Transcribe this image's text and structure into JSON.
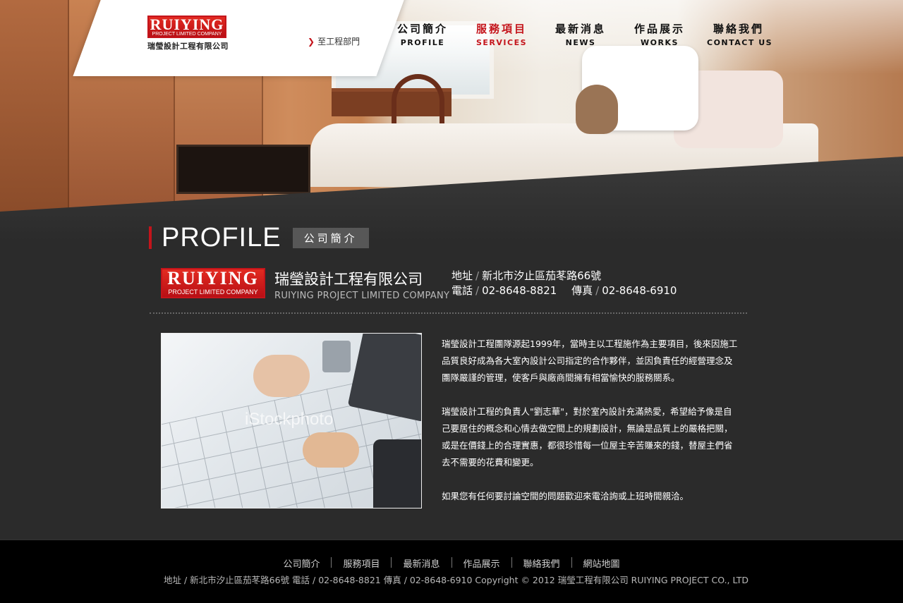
{
  "brand": {
    "mark": "RUIYING",
    "mark_sub": "PROJECT LIMITED COMPANY",
    "name_zh": "瑞瑩設計工程有限公司"
  },
  "header": {
    "dept_link": "至工程部門",
    "nav": [
      {
        "zh": "公司簡介",
        "en": "PROFILE"
      },
      {
        "zh": "服務項目",
        "en": "SERVICES"
      },
      {
        "zh": "最新消息",
        "en": "NEWS"
      },
      {
        "zh": "作品展示",
        "en": "WORKS"
      },
      {
        "zh": "聯絡我們",
        "en": "CONTACT US"
      }
    ]
  },
  "page": {
    "title_en": "PROFILE",
    "title_zh": "公司簡介"
  },
  "company": {
    "logo": "RUIYING",
    "logo_sub": "PROJECT LIMITED COMPANY",
    "name_zh": "瑞瑩設計工程有限公司",
    "name_en": "RUIYING PROJECT LIMITED COMPANY",
    "address_label": "地址",
    "address": "新北市汐止區茄苳路66號",
    "phone_label": "電話",
    "phone": "02-8648-8821",
    "fax_label": "傳真",
    "fax": "02-8648-6910",
    "separator": "/"
  },
  "photo": {
    "watermark": "iStockphoto"
  },
  "content": {
    "paragraphs": [
      "瑞瑩設計工程團隊源起1999年，當時主以工程施作為主要項目，後來因施工品質良好成為各大室內設計公司指定的合作夥伴，並因負責任的經營理念及團隊嚴謹的管理，使客戶與廠商間擁有相當愉快的服務關系。",
      "瑞瑩設計工程的負責人\"劉志華\"，對於室內設計充滿熱愛，希望給予像是自己要居住的概念和心情去做空間上的規劃設計，無論是品質上的嚴格把關，或是在價錢上的合理實惠，都很珍惜每一位屋主辛苦賺來的錢，替屋主們省去不需要的花費和變更。",
      "如果您有任何要討論空間的問題歡迎來電洽詢或上班時間親洽。"
    ]
  },
  "footer": {
    "nav": [
      "公司簡介",
      "服務項目",
      "最新消息",
      "作品展示",
      "聯絡我們",
      "網站地圖"
    ],
    "line": "地址 / 新北市汐止區茄苳路66號  電話 / 02-8648-8821  傳真 / 02-8648-6910   Copyright © 2012 瑞瑩工程有限公司 RUIYING PROJECT CO., LTD"
  },
  "colors": {
    "accent": "#c4141b",
    "background": "#2b2b2b",
    "footer": "#000000"
  }
}
